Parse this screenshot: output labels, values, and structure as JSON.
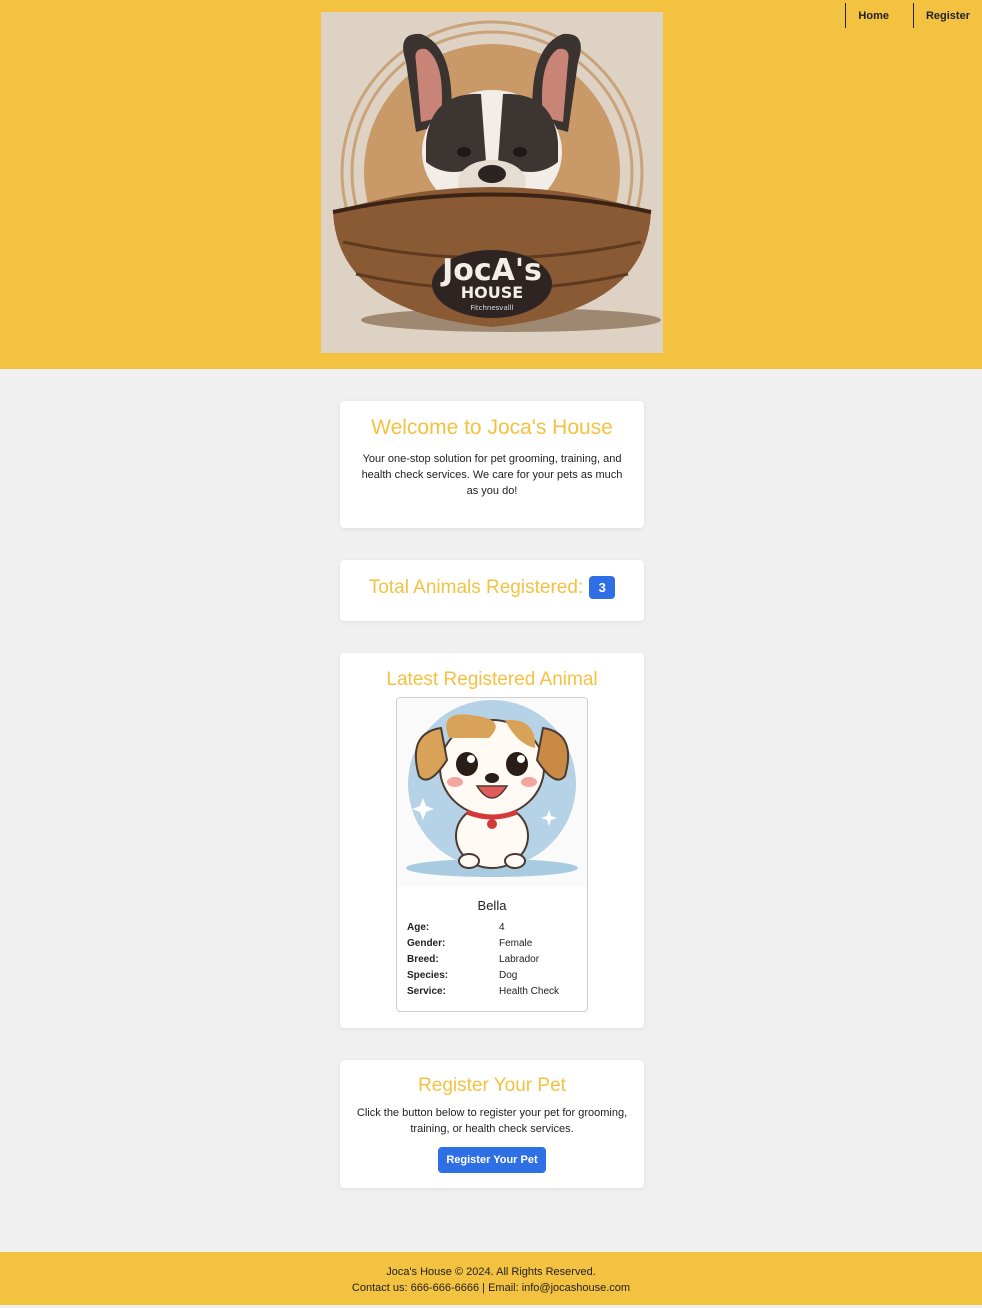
{
  "nav": {
    "home": "Home",
    "register": "Register"
  },
  "logo": {
    "line1": "JocA's",
    "line2": "HOUSE",
    "tagline": "Fitchnesvalll"
  },
  "welcome": {
    "title": "Welcome to Joca's House",
    "text": "Your one-stop solution for pet grooming, training, and health check services. We care for your pets as much as you do!"
  },
  "total": {
    "label": "Total Animals Registered:",
    "count": "3"
  },
  "latest": {
    "title": "Latest Registered Animal",
    "name": "Bella",
    "fields": [
      {
        "label": "Age:",
        "value": "4"
      },
      {
        "label": "Gender:",
        "value": "Female"
      },
      {
        "label": "Breed:",
        "value": "Labrador"
      },
      {
        "label": "Species:",
        "value": "Dog"
      },
      {
        "label": "Service:",
        "value": "Health Check"
      }
    ]
  },
  "register": {
    "title": "Register Your Pet",
    "text": "Click the button below to register your pet for grooming, training, or health check services.",
    "button": "Register Your Pet"
  },
  "footer": {
    "copyright": "Joca's House © 2024. All Rights Reserved.",
    "contact": "Contact us: 666-666-6666 | Email: info@jocashouse.com"
  },
  "colors": {
    "header": "#f4c241",
    "accent": "#2f6fe6",
    "background": "#f0f0f0"
  }
}
